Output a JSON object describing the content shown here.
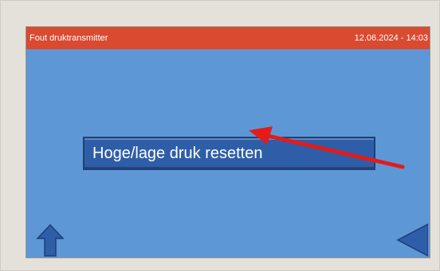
{
  "header": {
    "title": "Fout druktransmitter",
    "datetime": "12.06.2024 - 14:03"
  },
  "main": {
    "reset_button_label": "Hoge/lage druk resetten"
  },
  "icons": {
    "home": "home-icon",
    "back": "back-triangle-icon",
    "annotation": "red-arrow-annotation"
  },
  "colors": {
    "screen_bg": "#5d97d5",
    "header_bg": "#d94a31",
    "button_bg": "#2f5ea8",
    "annotation": "#e31b1b"
  }
}
